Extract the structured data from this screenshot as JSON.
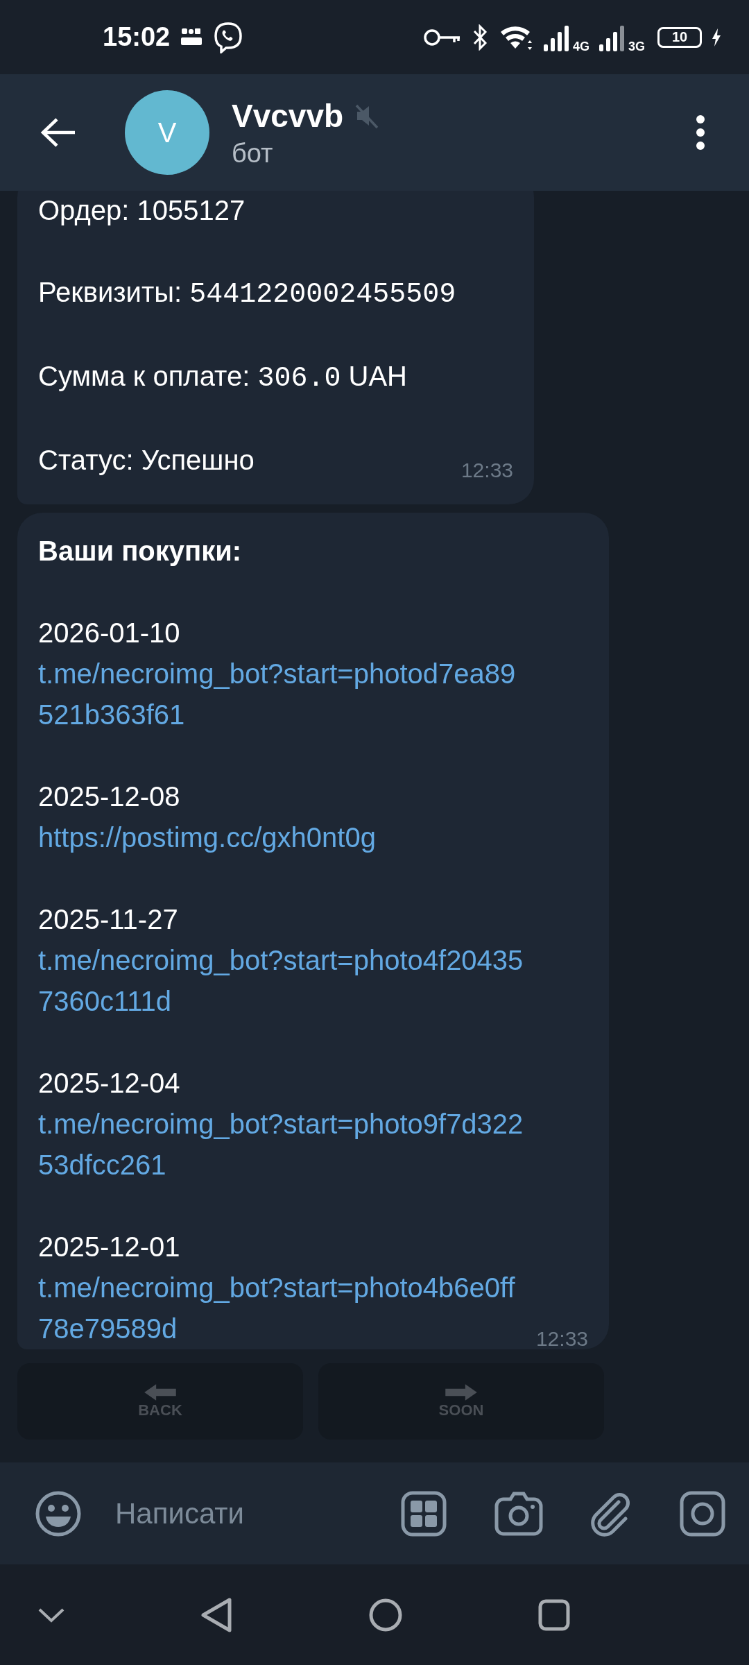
{
  "status_bar": {
    "time": "15:02",
    "network_labels": [
      "4G",
      "3G"
    ],
    "battery": "10"
  },
  "header": {
    "title": "Vvcvvb",
    "subtitle": "бот",
    "avatar_letter": "V",
    "muted": true
  },
  "messages": [
    {
      "blocks": [
        {
          "kind": "text",
          "segments": [
            {
              "text": "Ордер: 1055127"
            }
          ]
        },
        {
          "kind": "text",
          "segments": [
            {
              "text": "Реквизиты: "
            },
            {
              "text": "5441220002455509",
              "kind": "code"
            }
          ]
        },
        {
          "kind": "text",
          "segments": [
            {
              "text": "Сумма к оплате: "
            },
            {
              "text": "306.0",
              "kind": "code"
            },
            {
              "text": " UAH"
            }
          ]
        },
        {
          "kind": "text",
          "segments": [
            {
              "text": "Статус: Успешно"
            }
          ]
        }
      ],
      "time": "12:33"
    },
    {
      "blocks": [
        {
          "kind": "heading",
          "text": "Ваши покупки:"
        },
        {
          "kind": "entry",
          "date": "2026-01-10",
          "link": "t.me/necroimg_bot?start=photod7ea89521b363f61"
        },
        {
          "kind": "entry",
          "date": "2025-12-08",
          "link": "https://postimg.cc/gxh0nt0g"
        },
        {
          "kind": "entry",
          "date": "2025-11-27",
          "link": "t.me/necroimg_bot?start=photo4f204357360c111d"
        },
        {
          "kind": "entry",
          "date": "2025-12-04",
          "link": "t.me/necroimg_bot?start=photo9f7d32253dfcc261"
        },
        {
          "kind": "entry",
          "date": "2025-12-01",
          "link": "t.me/necroimg_bot?start=photo4b6e0ff78e79589d"
        }
      ],
      "time": "12:33"
    }
  ],
  "keyboard": [
    {
      "kind": "back",
      "label": "BACK"
    },
    {
      "kind": "forward",
      "label": "SOON"
    }
  ],
  "composer": {
    "placeholder": "Написати"
  }
}
